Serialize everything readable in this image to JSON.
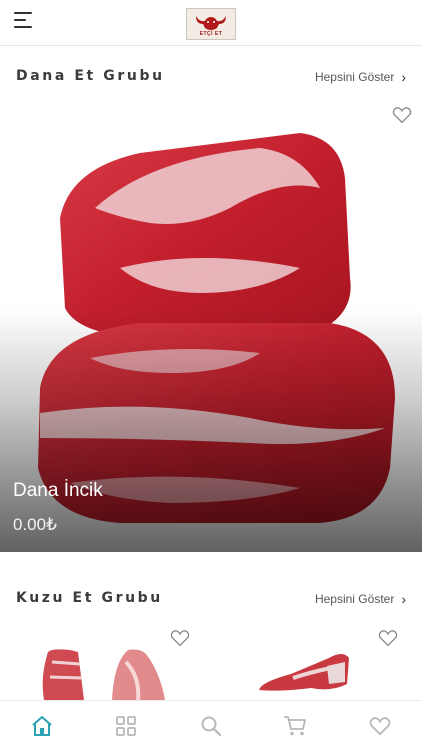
{
  "header": {
    "logo_text": "ETÇİ ET"
  },
  "sections": [
    {
      "title": "Dana Et Grubu",
      "see_all": "Hepsini Göster"
    },
    {
      "title": "Kuzu Et Grubu",
      "see_all": "Hepsini Göster"
    }
  ],
  "featured_product": {
    "name": "Dana İncik",
    "price": "0.00₺"
  },
  "tabs": [
    "home-icon",
    "grid-icon",
    "search-icon",
    "cart-icon",
    "heart-icon"
  ],
  "colors": {
    "accent": "#2ba3b3",
    "tab_inactive": "#b8b8b8",
    "meat_red": "#c4202f"
  }
}
